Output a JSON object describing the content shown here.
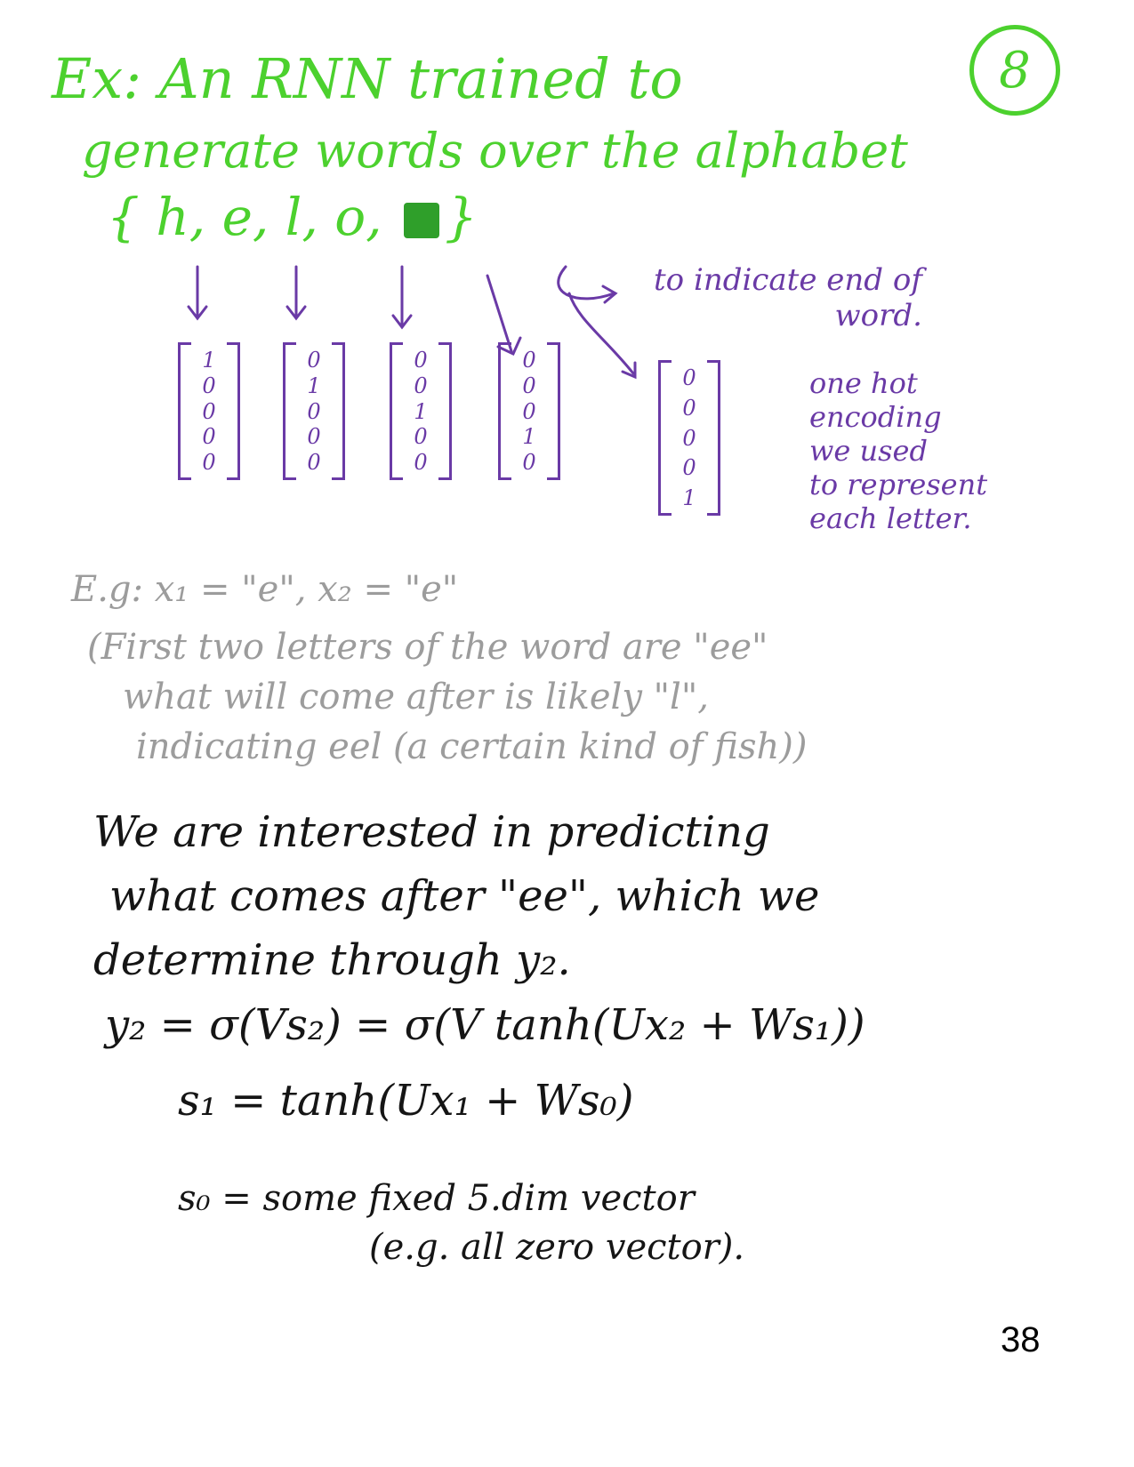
{
  "page_number_badge": "8",
  "title": {
    "line1": "Ex: An RNN trained to",
    "line2": "generate words over the alphabet"
  },
  "alphabet": {
    "open": "{",
    "letters": [
      "h",
      "e",
      "l",
      "o"
    ],
    "close": "}"
  },
  "end_of_word_note": {
    "line1": "to indicate end of",
    "line2": "word."
  },
  "one_hot_vectors": [
    [
      "1",
      "0",
      "0",
      "0",
      "0"
    ],
    [
      "0",
      "1",
      "0",
      "0",
      "0"
    ],
    [
      "0",
      "0",
      "1",
      "0",
      "0"
    ],
    [
      "0",
      "0",
      "0",
      "1",
      "0"
    ],
    [
      "0",
      "0",
      "0",
      "0",
      "1"
    ]
  ],
  "one_hot_note": {
    "line1": "one hot",
    "line2": "encoding",
    "line3": "we used",
    "line4": "to represent",
    "line5": "each letter."
  },
  "example": {
    "line": "E.g:   x₁ = \"e\",   x₂ = \"e\"",
    "paren1": "(First two letters of the word are \"ee\"",
    "paren2": "what will come after is likely \"l\",",
    "paren3": "indicating   eel (a certain kind of fish))"
  },
  "interest": {
    "line1": "We are interested in predicting",
    "line2": "what comes after \"ee\", which we",
    "line3": "determine through  y₂."
  },
  "equations": {
    "eq1": "y₂ = σ(Vs₂) = σ(V tanh(Ux₂ + Ws₁))",
    "eq2": "s₁ = tanh(Ux₁ + Ws₀)",
    "eq3": "s₀ =  some fixed 5.dim vector",
    "eq4": "(e.g. all zero vector)."
  },
  "page_number": "38"
}
